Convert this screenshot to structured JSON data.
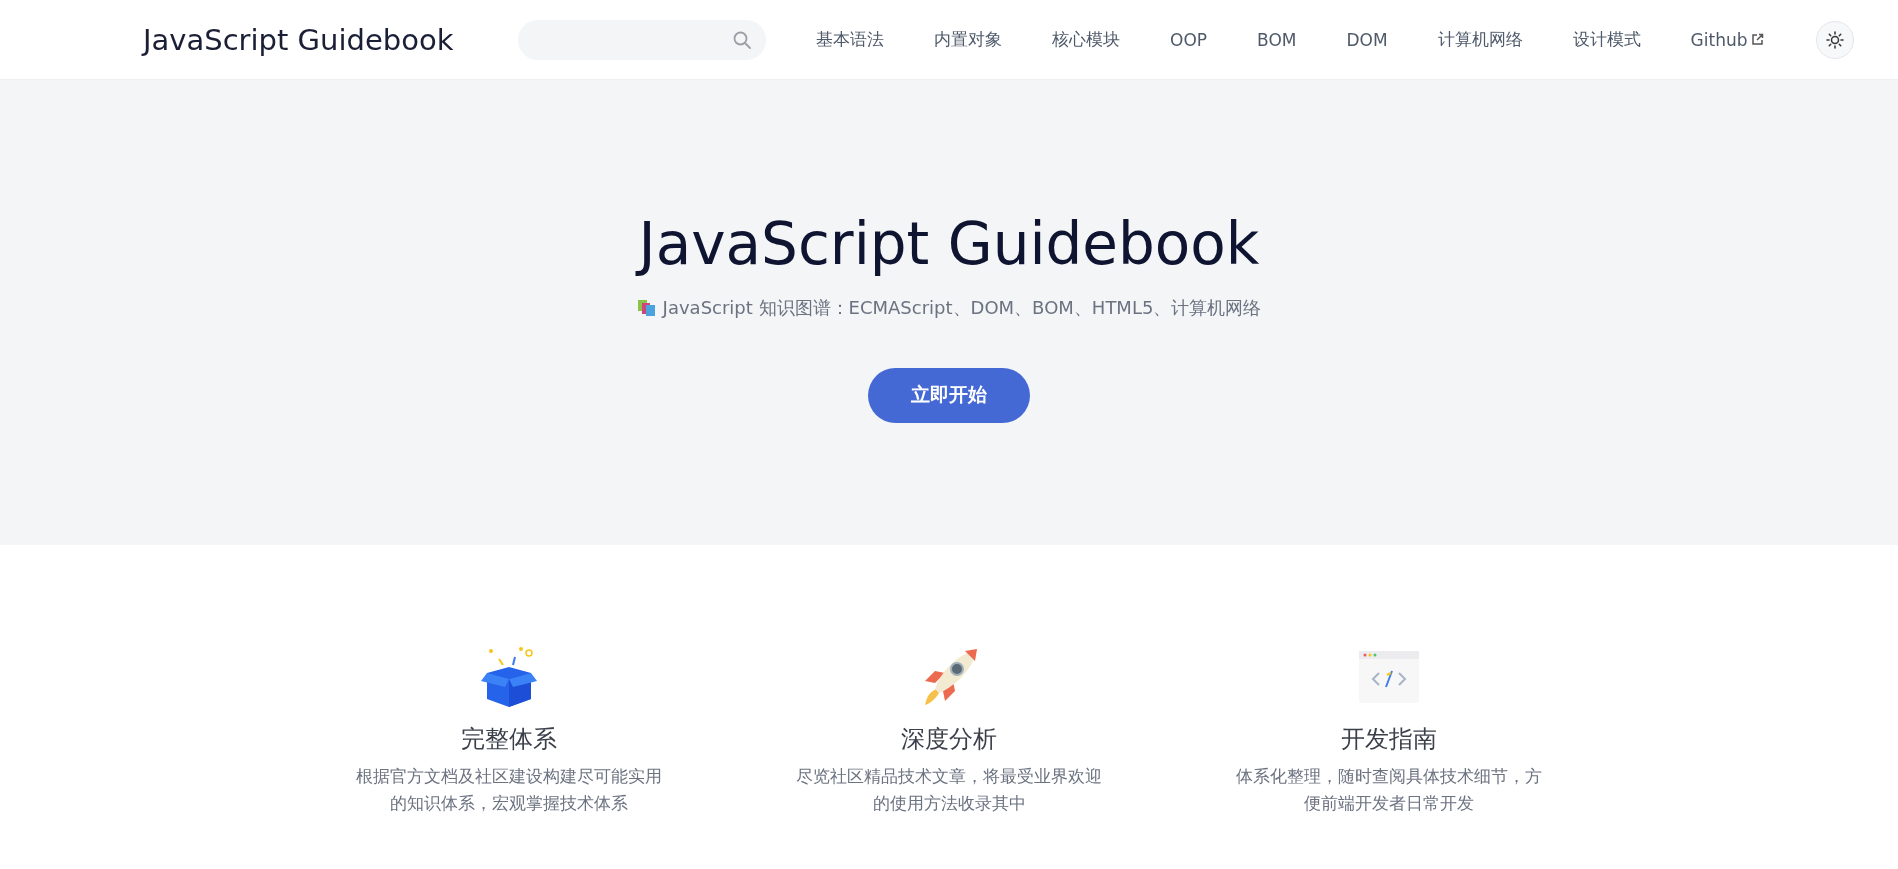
{
  "header": {
    "site_title": "JavaScript Guidebook",
    "nav": [
      {
        "label": "基本语法",
        "kind": "link"
      },
      {
        "label": "内置对象",
        "kind": "link"
      },
      {
        "label": "核心模块",
        "kind": "link"
      },
      {
        "label": "OOP",
        "kind": "link"
      },
      {
        "label": "BOM",
        "kind": "link"
      },
      {
        "label": "DOM",
        "kind": "link"
      },
      {
        "label": "计算机网络",
        "kind": "link"
      },
      {
        "label": "设计模式",
        "kind": "link"
      },
      {
        "label": "Github",
        "kind": "external"
      }
    ]
  },
  "hero": {
    "title": "JavaScript Guidebook",
    "tagline": "JavaScript 知识图谱：ECMAScript、DOM、BOM、HTML5、计算机网络",
    "action": "立即开始"
  },
  "features": [
    {
      "kind": "box",
      "title": "完整体系",
      "description": "根据官方文档及社区建设构建尽可能实用的知识体系，宏观掌握技术体系"
    },
    {
      "kind": "rocket",
      "title": "深度分析",
      "description": "尽览社区精品技术文章，将最受业界欢迎的使用方法收录其中"
    },
    {
      "kind": "code",
      "title": "开发指南",
      "description": "体系化整理，随时查阅具体技术细节，方便前端开发者日常开发"
    }
  ]
}
